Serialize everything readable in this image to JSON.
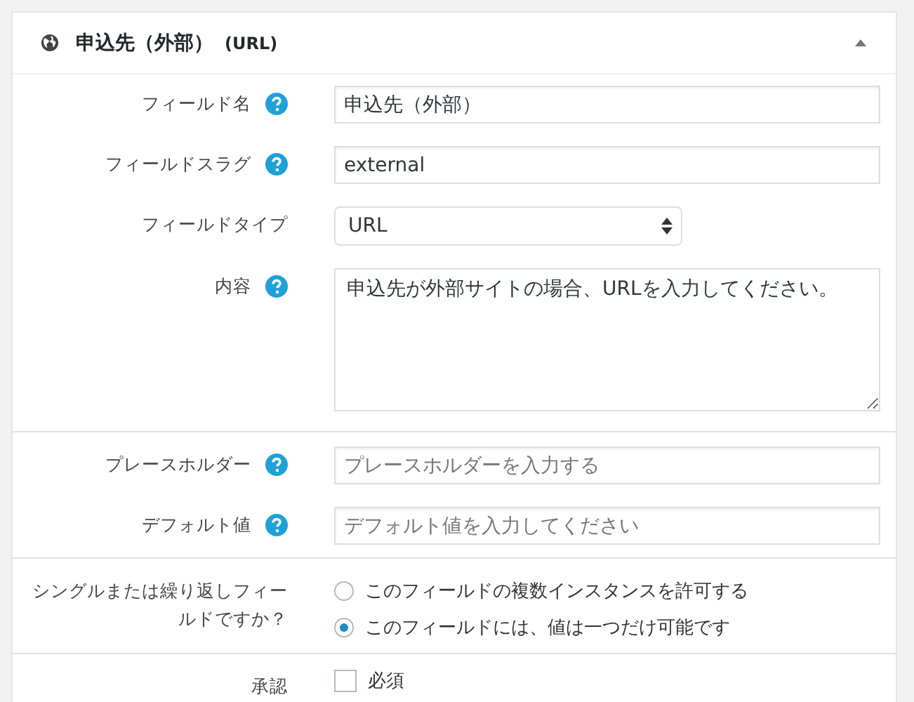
{
  "panel": {
    "title": "申込先（外部）",
    "type_tag": "(URL)",
    "expanded": true
  },
  "sections": [
    {
      "rows": [
        {
          "kind": "text",
          "label": "フィールド名",
          "help": true,
          "value": "申込先（外部）"
        },
        {
          "kind": "text",
          "label": "フィールドスラグ",
          "help": true,
          "value": "external"
        },
        {
          "kind": "select",
          "label": "フィールドタイプ",
          "help": false,
          "value": "URL"
        },
        {
          "kind": "textarea",
          "label": "内容",
          "help": true,
          "value": "申込先が外部サイトの場合、URLを入力してください。"
        }
      ]
    },
    {
      "rows": [
        {
          "kind": "text",
          "label": "プレースホルダー",
          "help": true,
          "placeholder": "プレースホルダーを入力する"
        },
        {
          "kind": "text",
          "label": "デフォルト値",
          "help": true,
          "placeholder": "デフォルト値を入力してください"
        }
      ]
    },
    {
      "rows": [
        {
          "kind": "radio",
          "label": "シングルまたは繰り返しフィールドですか？",
          "help": false,
          "options": [
            {
              "label": "このフィールドの複数インスタンスを許可する",
              "selected": false
            },
            {
              "label": "このフィールドには、値は一つだけ可能です",
              "selected": true
            }
          ]
        }
      ]
    },
    {
      "rows": [
        {
          "kind": "checkbox",
          "label": "承認",
          "help": false,
          "option": "必須",
          "checked": false
        }
      ]
    }
  ]
}
